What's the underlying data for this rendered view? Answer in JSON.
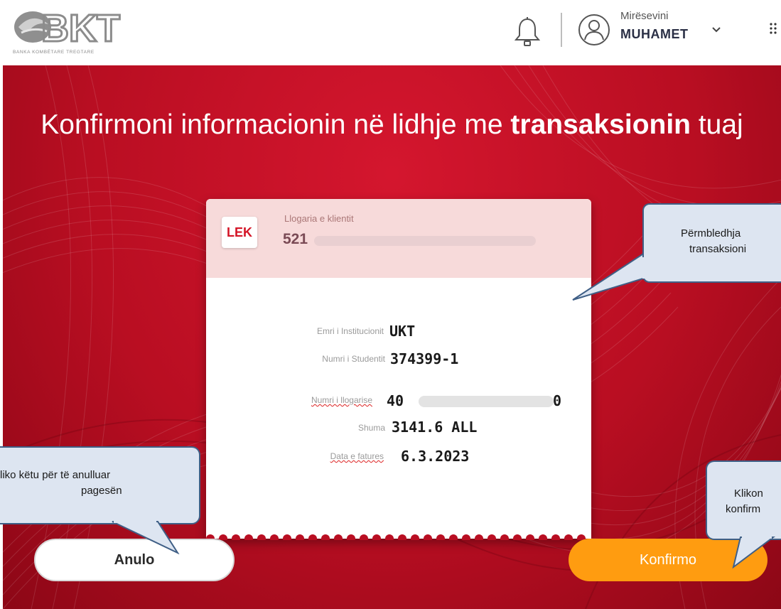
{
  "header": {
    "logo_text": "BKT",
    "logo_caption": "BANKA KOMBËTARE TREGTARE",
    "greeting": "Mirësevini",
    "username": "MUHAMET",
    "icons": [
      "bell-icon",
      "user-avatar-icon",
      "chevron-down-icon",
      "grid-menu-icon"
    ]
  },
  "page": {
    "title_prefix": "Konfirmoni informacionin në lidhje me ",
    "title_bold": "transaksionin",
    "title_suffix": " tuaj"
  },
  "card": {
    "currency_badge": "LEK",
    "account_label": "Llogaria e klientit",
    "account_number": "521",
    "fields": [
      {
        "label": "Emri i Institucionit",
        "value": "UKT"
      },
      {
        "label": "Numri i Studentit",
        "value": "374399-1"
      },
      {
        "label": "Numri i llogarise",
        "value_start": "40",
        "value_end": "0"
      },
      {
        "label": "Shuma",
        "value": "3141.6 ALL"
      },
      {
        "label": "Data e fatures",
        "value": "6.3.2023"
      }
    ]
  },
  "buttons": {
    "cancel": "Anulo",
    "confirm": "Konfirmo"
  },
  "callouts": {
    "summary_line1": "Përmbledhja",
    "summary_line2": "transaksioni",
    "cancel_line1": "liko këtu për të anulluar",
    "cancel_line2": "pagesën",
    "confirm_line1": "Klikon",
    "confirm_line2": "konfirm"
  },
  "colors": {
    "brand_red": "#c8102e",
    "confirm_orange": "#ff9c10",
    "callout_fill": "#dde5f1",
    "callout_border": "#3f5f86"
  }
}
